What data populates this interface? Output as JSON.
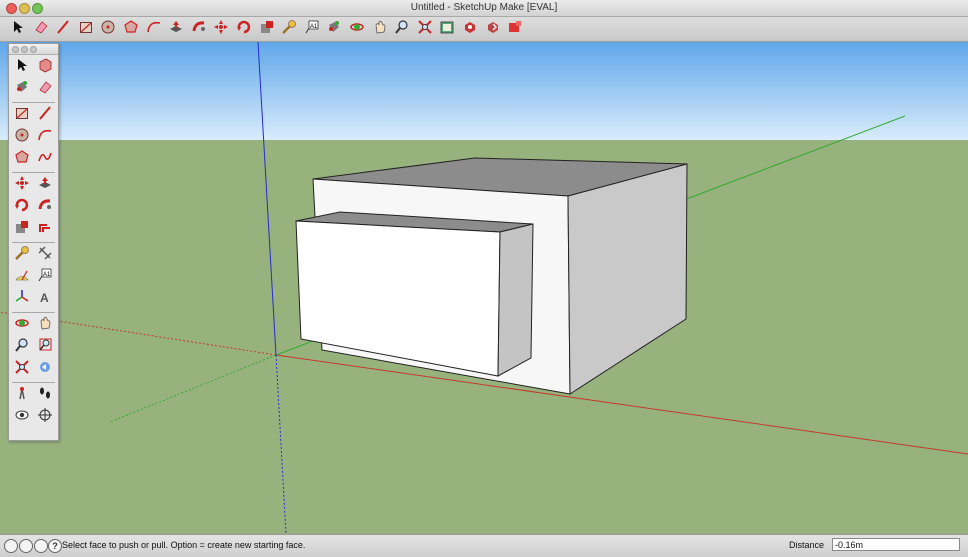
{
  "window": {
    "title": "Untitled - SketchUp Make [EVAL]"
  },
  "toolbar": {
    "tools": [
      "select-icon",
      "eraser-icon",
      "line-icon",
      "rectangle-icon",
      "circle-icon",
      "polygon-icon",
      "arc-icon",
      "push-pull-icon",
      "follow-me-icon",
      "move-icon",
      "rotate-icon",
      "scale-icon",
      "tape-measure-icon",
      "text-icon",
      "paint-bucket-icon",
      "orbit-icon",
      "pan-icon",
      "zoom-icon",
      "zoom-extents-icon",
      "3d-warehouse-icon",
      "get-models-icon",
      "share-model-icon",
      "extension-warehouse-icon"
    ]
  },
  "palette": {
    "tools": [
      [
        "select-icon",
        "make-component-icon"
      ],
      [
        "paint-bucket-icon",
        "eraser-icon"
      ],
      [
        "rectangle-icon",
        "line-icon"
      ],
      [
        "circle-icon",
        "arc-icon"
      ],
      [
        "polygon-icon",
        "freehand-icon"
      ],
      [
        "move-icon",
        "push-pull-icon"
      ],
      [
        "rotate-icon",
        "follow-me-icon"
      ],
      [
        "scale-icon",
        "offset-icon"
      ],
      [
        "tape-measure-icon",
        "dimensions-icon"
      ],
      [
        "protractor-icon",
        "text-icon"
      ],
      [
        "axes-icon",
        "3d-text-icon"
      ],
      [
        "orbit-icon",
        "pan-icon"
      ],
      [
        "zoom-icon",
        "zoom-window-icon"
      ],
      [
        "zoom-extents-icon",
        "previous-view-icon"
      ],
      [
        "position-camera-icon",
        "walk-icon"
      ],
      [
        "look-around-icon",
        "section-plane-icon"
      ]
    ]
  },
  "colors": {
    "sky_top": "#5fa7ea",
    "sky_bottom": "#d9ecfb",
    "ground": "#98b27e",
    "red_axis": "#c23a2c",
    "green_axis": "#33aa33",
    "blue_axis": "#2a2ad0"
  },
  "status": {
    "message": "Select face to push or pull.  Option = create new starting face.",
    "measurement_label": "Distance",
    "measurement_value": "-0.16m"
  }
}
